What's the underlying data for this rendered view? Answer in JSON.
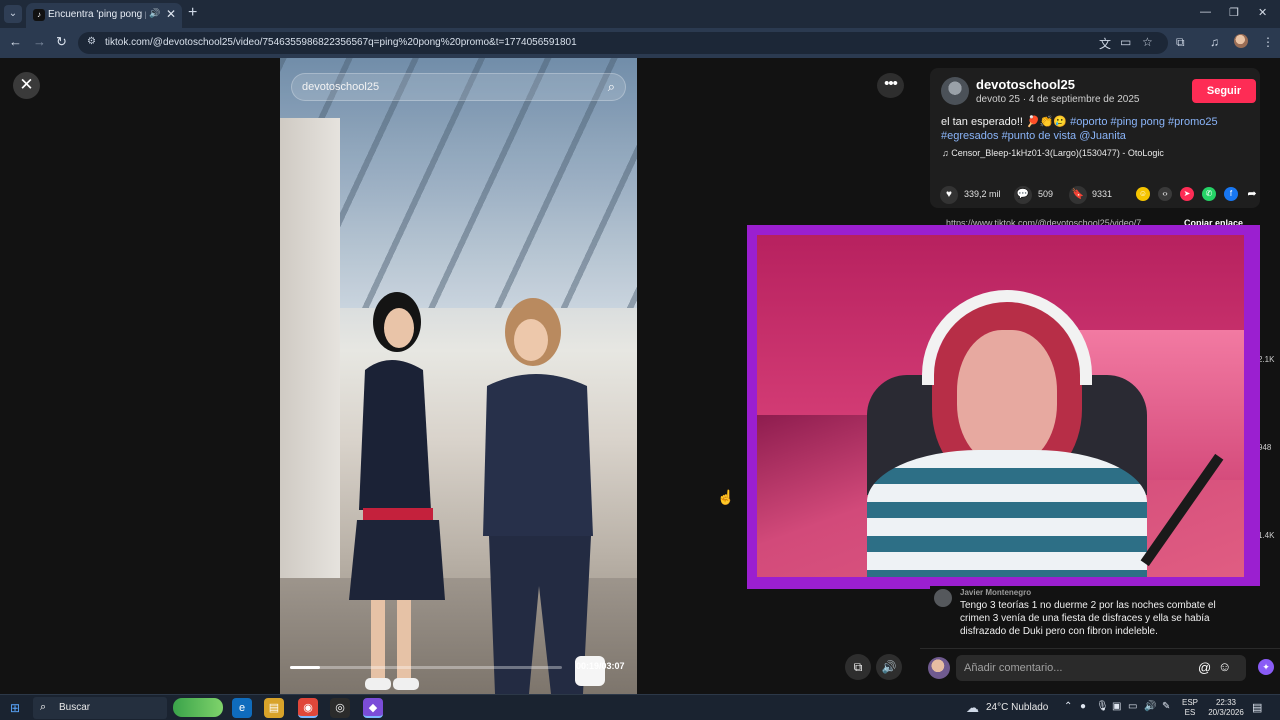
{
  "browser": {
    "tab_title": "Encuentra 'ping pong prom",
    "url": "tiktok.com/@devotoschool25/video/7546355986822356567q=ping%20pong%20promo&t=1774056591801"
  },
  "video": {
    "search_placeholder": "devotoschool25",
    "time": "00:19/03:07",
    "progress": 0.11
  },
  "post": {
    "author": "devotoschool25",
    "meta": "devoto 25 · 4 de septiembre de 2025",
    "follow_label": "Seguir",
    "description_text": "el tan esperado!! 🏓👏🥲",
    "tags": [
      "#oporto",
      "#ping pong",
      "#promo25",
      "#egresados",
      "#punto de vista",
      "@Juanita"
    ],
    "music": "Censor_Bleep-1kHz01-3(Largo)(1530477) - OtoLogic",
    "likes": "339,2 mil",
    "comments": "509",
    "saves": "9331",
    "link": "https://www.tiktok.com/@devotoschool25/video/7...",
    "copy_link": "Copiar enlace",
    "side_counts": [
      "2.1K",
      "948",
      "1.4K"
    ]
  },
  "comment": {
    "author": "Javier Montenegro",
    "text": "Tengo 3 teorías 1 no duerme 2 por las noches combate el crimen 3 venía de una fiesta de disfraces y ella se había disfrazado de Duki pero con fibron indeleble."
  },
  "add_comment": {
    "placeholder": "Añadir comentario..."
  },
  "taskbar": {
    "search_label": "Buscar",
    "weather": "24°C  Nublado",
    "lang_top": "ESP",
    "lang_bottom": "ES",
    "time": "22:33",
    "date": "20/3/2026"
  },
  "colors": {
    "follow": "#fe2c55",
    "tag": "#8ab4f8",
    "cam_border": "#9b1fd0"
  }
}
